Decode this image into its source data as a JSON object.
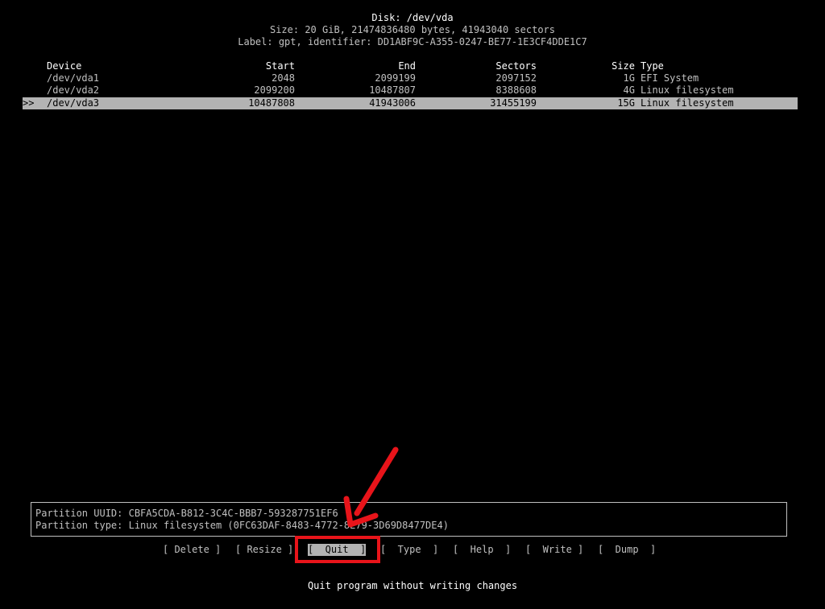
{
  "header": {
    "disk": "Disk: /dev/vda",
    "size": "Size: 20 GiB, 21474836480 bytes, 41943040 sectors",
    "label": "Label: gpt, identifier: DD1ABF9C-A355-0247-BE77-1E3CF4DDE1C7"
  },
  "table": {
    "columns": {
      "device": "Device",
      "start": "Start",
      "end": "End",
      "sectors": "Sectors",
      "size": "Size",
      "type": "Type"
    },
    "rows": [
      {
        "marker": "",
        "device": "/dev/vda1",
        "start": "2048",
        "end": "2099199",
        "sectors": "2097152",
        "size": "1G",
        "type": "EFI System"
      },
      {
        "marker": "",
        "device": "/dev/vda2",
        "start": "2099200",
        "end": "10487807",
        "sectors": "8388608",
        "size": "4G",
        "type": "Linux filesystem"
      },
      {
        "marker": ">>",
        "device": "/dev/vda3",
        "start": "10487808",
        "end": "41943006",
        "sectors": "31455199",
        "size": "15G",
        "type": "Linux filesystem"
      }
    ]
  },
  "info": {
    "uuid": "Partition UUID: CBFA5CDA-B812-3C4C-BBB7-593287751EF6",
    "type": "Partition type: Linux filesystem (0FC63DAF-8483-4772-8E79-3D69D8477DE4)"
  },
  "menu": {
    "delete": "[ Delete ]",
    "resize": "[ Resize ]",
    "quit": "[  Quit  ]",
    "type": "[  Type  ]",
    "help": "[  Help  ]",
    "write": "[  Write ]",
    "dump": "[  Dump  ]"
  },
  "status": "Quit program without writing changes",
  "colors": {
    "background": "#000000",
    "text": "#c0c0c0",
    "selection": "#b3b3b3",
    "annotation": "#e8141a"
  }
}
